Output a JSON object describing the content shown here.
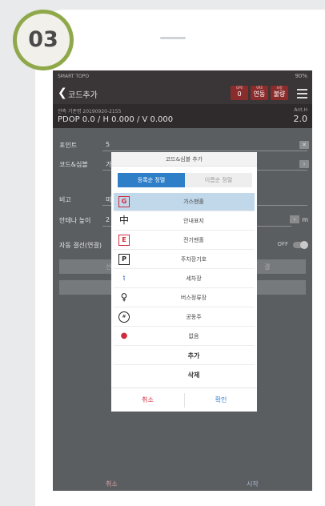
{
  "step_badge": "03",
  "status_bar": {
    "left": "SMART TOPO",
    "battery": "90%"
  },
  "app_bar": {
    "title": "코드추가",
    "pills": [
      {
        "top": "GPS",
        "value": "0"
      },
      {
        "top": "VRS",
        "value": "연동"
      },
      {
        "top": "보정",
        "value": "불량"
      }
    ]
  },
  "info": {
    "line": "관측 기준명 20190920-2155",
    "pdop": "PDOP 0.0 / H 0.000 / V 0.000",
    "anth_label": "Ant.H",
    "anth_value": "2.0"
  },
  "form": {
    "point_label": "포인트",
    "point_value": "5",
    "code_label": "코드&심볼",
    "code_value": "가",
    "note_label": "비고",
    "note_value": "미",
    "antenna_label": "안테나 높이",
    "antenna_value": "2",
    "antenna_unit": "m",
    "auto_label": "자동 결선(연결)",
    "auto_state": "OFF",
    "bg_btn_a": "선",
    "bg_btn_b": "결"
  },
  "bottom": {
    "cancel": "취소",
    "start": "시작"
  },
  "dialog": {
    "title": "코드&심볼 추가",
    "tab_selected": "등록순 정렬",
    "tab_other": "이름순 정렬",
    "items": [
      {
        "icon": "G",
        "label": "가스맨홀"
      },
      {
        "icon": "中",
        "label": "안내표지"
      },
      {
        "icon": "E",
        "label": "전기맨홀"
      },
      {
        "icon": "P",
        "label": "주차장기호"
      },
      {
        "icon": "bell",
        "label": "세차장"
      },
      {
        "icon": "bus",
        "label": "버스정류장"
      },
      {
        "icon": "pole",
        "label": "공동주"
      },
      {
        "icon": "dot",
        "label": "없음"
      }
    ],
    "add_label": "추가",
    "delete_label": "삭제",
    "cancel": "취소",
    "confirm": "확인"
  }
}
